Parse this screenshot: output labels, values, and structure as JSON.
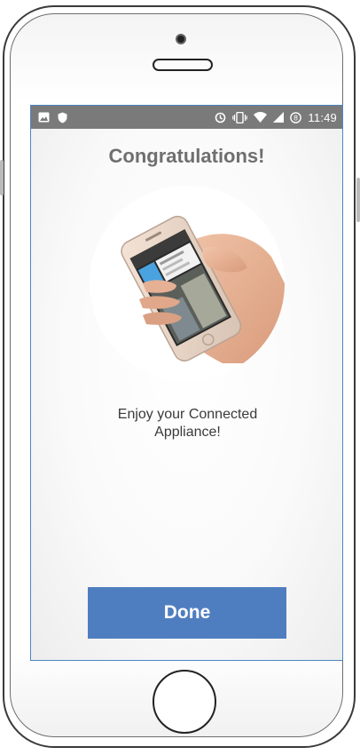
{
  "device": {
    "type": "smartphone-mockup"
  },
  "status_bar": {
    "time": "11:49",
    "left_icons": [
      "image-icon",
      "shield-icon"
    ],
    "right_icons": [
      "sync-icon",
      "vibrate-icon",
      "wifi-icon",
      "signal-icon",
      "battery-icon"
    ]
  },
  "screen": {
    "title": "Congratulations!",
    "message_line1": "Enjoy your Connected",
    "message_line2": "Appliance!",
    "hero_image": "hand-holding-phone-icon",
    "done_button": {
      "label": "Done",
      "color": "#4f7ec0"
    }
  },
  "colors": {
    "status_bar": "#7a7a7a",
    "title_text": "#6f6f6f",
    "screen_border": "#4d86c4"
  }
}
